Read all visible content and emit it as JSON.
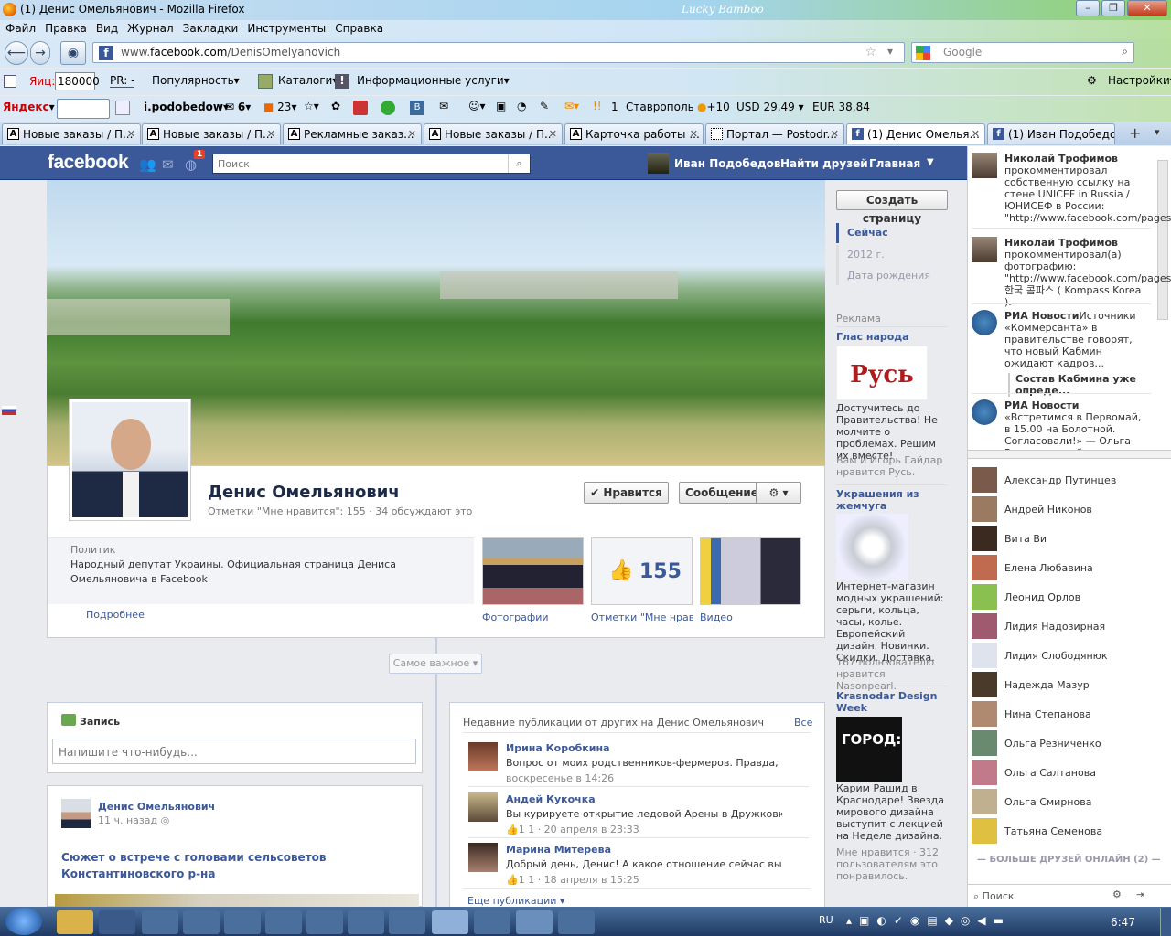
{
  "window": {
    "title": "(1) Денис Омельянович - Mozilla Firefox",
    "theme_label": "Lucky Bamboo"
  },
  "menu": [
    "Файл",
    "Правка",
    "Вид",
    "Журнал",
    "Закладки",
    "Инструменты",
    "Справка"
  ],
  "address": {
    "prefix": "www.",
    "host": "facebook.com",
    "path": "/DenisOmelyanovich"
  },
  "search_engine_placeholder": "Google",
  "yandex_bar": {
    "tic_label": "Яиц:",
    "tic_value": "180000",
    "pr_label": "PR: -",
    "popular": "Популярность",
    "catalogs": "Каталоги",
    "info": "Информационные услуги",
    "settings": "Настройки"
  },
  "yandex_bar2": {
    "brand": "Яндекс",
    "user": "i.podobedow",
    "mail_count": "6",
    "feed_count": "23",
    "likes": "1",
    "city": "Ставрополь",
    "weather": "+10",
    "usd": "USD 29,49",
    "eur": "EUR 38,84"
  },
  "tabs": [
    {
      "label": "Новые заказы / П...",
      "icon": "A"
    },
    {
      "label": "Новые заказы / П...",
      "icon": "A"
    },
    {
      "label": "Рекламные заказ...",
      "icon": "A"
    },
    {
      "label": "Новые заказы / П...",
      "icon": "A"
    },
    {
      "label": "Карточка работы ...",
      "icon": "A"
    },
    {
      "label": "Портал — Postodr...",
      "icon": ""
    },
    {
      "label": "(1) Денис Омелья...",
      "icon": "f"
    },
    {
      "label": "(1) Иван Подобедов",
      "icon": "f"
    }
  ],
  "fb": {
    "logo": "facebook",
    "notif_count": "1",
    "search_placeholder": "Поиск",
    "user_name": "Иван Подобедов",
    "find_friends": "Найти друзей",
    "home": "Главная",
    "page_name": "Денис Омельянович",
    "page_stats": "Отметки \"Мне нравится\": 155 · 34 обсуждают это",
    "like_btn": "Нравится",
    "message_btn": "Сообщение",
    "category": "Политик",
    "about": "Народный депутат Украины. Официальная страница Дениса Омельяновича в Facebook",
    "more": "Подробнее",
    "likes_count": "155",
    "cap_photos": "Фотографии",
    "cap_likes": "Отметки \"Мне нравится\"",
    "cap_videos": "Видео",
    "create_page": "Создать страницу",
    "timeline": [
      "Сейчас",
      "2012 г.",
      "Дата рождения"
    ],
    "highlights": "Самое важное",
    "post_label": "Запись",
    "post_placeholder": "Напишите что-нибудь...",
    "post_author": "Денис Омельянович",
    "post_time": "11 ч. назад",
    "post_title": "Сюжет о встрече с головами сельсоветов Константиновского р-на",
    "recent_header": "Недавние публикации от других на Денис Омельянович",
    "recent_all": "Все",
    "recent_more": "Еще публикации",
    "recent": [
      {
        "name": "Ирина Коробкина",
        "text": "Вопрос от моих родственников-фермеров. Правда, что по",
        "meta": "воскресенье в 14:26"
      },
      {
        "name": "Андей Кукочка",
        "text": "Вы курируете открытие ледовой Арены в Дружковке. У не",
        "meta": "1   1 · 20 апреля в 23:33"
      },
      {
        "name": "Марина Митерева",
        "text": "Добрый день, Денис! А какое отношение сейчас вы имеете",
        "meta": "1   1 · 18 апреля в 15:25"
      }
    ],
    "ads_title": "Реклама",
    "ads": [
      {
        "title": "Глас народа",
        "image_text": "Русь",
        "text": "Достучитесь до Правительства! Не молчите о проблемах. Решим их вместе!",
        "social": "Вам и Игорь Гайдар нравится Русь."
      },
      {
        "title": "Украшения из жемчуга",
        "text": "Интернет-магазин модных украшений: серьги, кольца, часы, колье. Европейский дизайн. Новинки. Скидки. Доставка.",
        "social": "167 пользователю нравится Nasonpearl."
      },
      {
        "title": "Krasnodar Design Week",
        "image_text": "ГОРОД:",
        "text": "Карим Рашид в Краснодаре! Звезда мирового дизайна выступит с лекцией на Неделе дизайна.",
        "social": "Мне нравится · 312 пользователям это понравилось."
      }
    ]
  },
  "ticker": [
    {
      "name": "Николай Трофимов",
      "text": "прокомментировал собственную ссылку на стене UNICEF in Russia / ЮНИСЕФ в России: \"http://www.facebook.com/pages/...\""
    },
    {
      "name": "Николай Трофимов",
      "text": "прокомментировал(а) фотографию: \"http://www.facebook.com/pages/...\" 한국 콤파스 ( Kompass Korea )."
    },
    {
      "name": "РИА Новости",
      "text": "Источники «Коммерсанта» в правительстве говорят, что новый Кабмин ожидают кадров...",
      "sub": "Состав Кабмина уже опреде..."
    },
    {
      "name": "РИА Новости",
      "text": "«Встретимся в Первомай, в 15.00 на Болотной. Согласовали!» — Ольга Романова сооб..."
    }
  ],
  "friends": [
    "Александр Путинцев",
    "Андрей Никонов",
    "Вита Ви",
    "Елена Любавина",
    "Леонид Орлов",
    "Лидия Надозирная",
    "Лидия Слободянюк",
    "Надежда Мазур",
    "Нина Степанова",
    "Ольга Резниченко",
    "Ольга Салтанова",
    "Ольга Смирнова",
    "Татьяна Семенова"
  ],
  "more_friends": "БОЛЬШЕ ДРУЗЕЙ ОНЛАЙН (2)",
  "chat_search": "Поиск",
  "tray": {
    "lang": "RU",
    "time": "6:47"
  }
}
